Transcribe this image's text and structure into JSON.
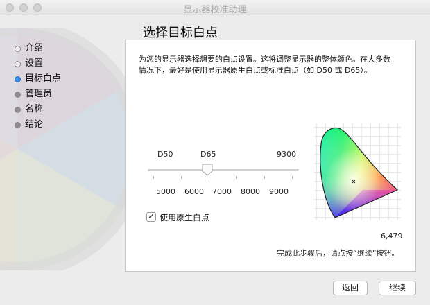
{
  "window": {
    "title": "显示器校准助理"
  },
  "page": {
    "heading": "选择目标白点"
  },
  "steps": [
    {
      "label": "介绍",
      "state": "done"
    },
    {
      "label": "设置",
      "state": "done"
    },
    {
      "label": "目标白点",
      "state": "current"
    },
    {
      "label": "管理员",
      "state": "todo"
    },
    {
      "label": "名称",
      "state": "todo"
    },
    {
      "label": "结论",
      "state": "todo"
    }
  ],
  "panel": {
    "description_line1": "为您的显示器选择想要的白点设置。这将调整显示器的整体颜色。在大多数",
    "description_line2": "情况下，最好是使用显示器原生白点或标准白点（如 D50 或 D65）。",
    "slider": {
      "top_labels": [
        "D50",
        "D65",
        "9300"
      ],
      "bottom_labels": [
        "5000",
        "6000",
        "7000",
        "8000",
        "9000"
      ],
      "value_kelvin": 6479
    },
    "checkbox": {
      "label": "使用原生白点",
      "checked": true,
      "mark": "✓"
    },
    "value_readout": "6,479",
    "hint": "完成此步骤后，请点按“继续”按钮。"
  },
  "buttons": {
    "back": "返回",
    "continue": "继续"
  },
  "colors": {
    "accent": "#3c8ee8",
    "panel_border": "#c6c6c6",
    "background": "#ececec"
  },
  "icons": [
    "cie-chromaticity-diagram-icon",
    "slider-thumb-icon",
    "checkmark-icon"
  ]
}
